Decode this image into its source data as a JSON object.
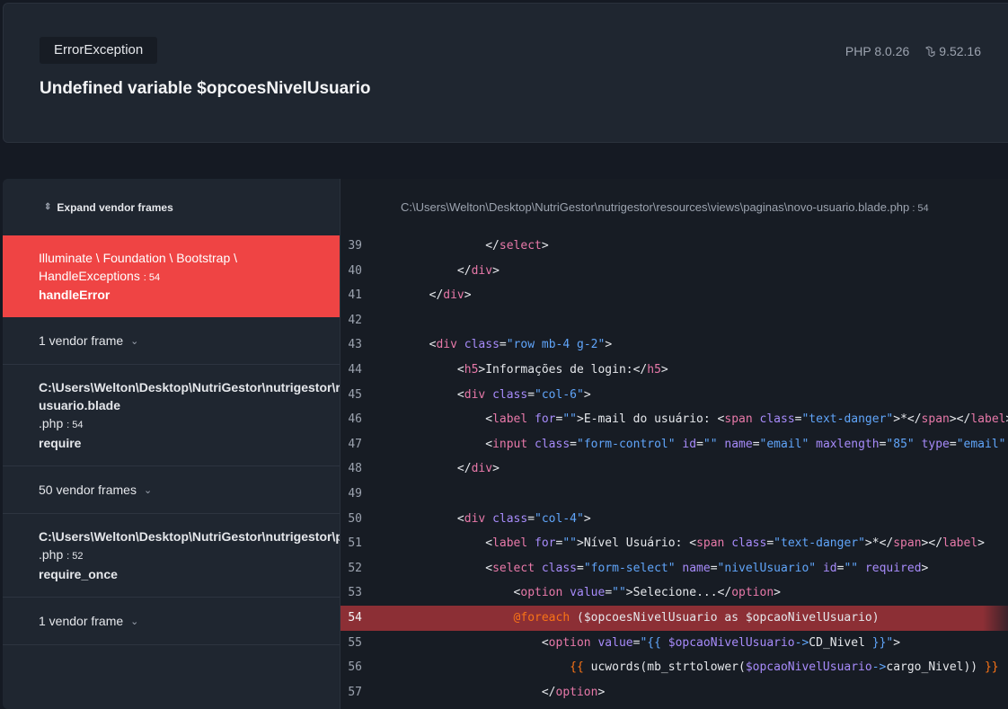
{
  "header": {
    "exception_class": "ErrorException",
    "message": "Undefined variable $opcoesNivelUsuario",
    "php_version": "PHP 8.0.26",
    "laravel_version": "9.52.16"
  },
  "frames_panel": {
    "expand_label": "Expand vendor frames",
    "active_frame": {
      "class_line1": "Illuminate \\ Foundation \\ Bootstrap \\",
      "class_line2": "HandleExceptions",
      "line": ": 54",
      "method": "handleError"
    },
    "vendor_group_1": "1 vendor frame",
    "app_frame_1": {
      "path": "C:\\Users\\Welton\\Desktop\\NutriGestor\\nutrigestor\\resources\\views\\paginas\\novo-",
      "path2": "usuario.blade",
      "ext": ".php",
      "line": ": 54",
      "method": "require"
    },
    "vendor_group_2": "50 vendor frames",
    "app_frame_2": {
      "path": "C:\\Users\\Welton\\Desktop\\NutriGestor\\nutrigestor\\public\\index",
      "ext": ".php",
      "line": ": 52",
      "method": "require_once"
    },
    "vendor_group_3": "1 vendor frame"
  },
  "code_panel": {
    "file_path": "C:\\Users\\Welton\\Desktop\\NutriGestor\\nutrigestor\\resources\\views\\paginas\\novo-usuario.blade",
    "file_ext": ".php",
    "file_line": " : 54",
    "highlight_line": 54,
    "lines": [
      {
        "n": "39",
        "tokens": [
          [
            "t-text",
            "                "
          ],
          [
            "t-punct",
            "</"
          ],
          [
            "t-tag",
            "select"
          ],
          [
            "t-punct",
            ">"
          ]
        ]
      },
      {
        "n": "40",
        "tokens": [
          [
            "t-text",
            "            "
          ],
          [
            "t-punct",
            "</"
          ],
          [
            "t-tag",
            "div"
          ],
          [
            "t-punct",
            ">"
          ]
        ]
      },
      {
        "n": "41",
        "tokens": [
          [
            "t-text",
            "        "
          ],
          [
            "t-punct",
            "</"
          ],
          [
            "t-tag",
            "div"
          ],
          [
            "t-punct",
            ">"
          ]
        ]
      },
      {
        "n": "42",
        "tokens": []
      },
      {
        "n": "43",
        "tokens": [
          [
            "t-text",
            "        "
          ],
          [
            "t-punct",
            "<"
          ],
          [
            "t-tag",
            "div "
          ],
          [
            "t-attr",
            "class"
          ],
          [
            "t-punct",
            "="
          ],
          [
            "t-str",
            "\"row mb-4 g-2\""
          ],
          [
            "t-punct",
            ">"
          ]
        ]
      },
      {
        "n": "44",
        "tokens": [
          [
            "t-text",
            "            "
          ],
          [
            "t-punct",
            "<"
          ],
          [
            "t-tag",
            "h5"
          ],
          [
            "t-punct",
            ">"
          ],
          [
            "t-text",
            "Informações de login:"
          ],
          [
            "t-punct",
            "</"
          ],
          [
            "t-tag",
            "h5"
          ],
          [
            "t-punct",
            ">"
          ]
        ]
      },
      {
        "n": "45",
        "tokens": [
          [
            "t-text",
            "            "
          ],
          [
            "t-punct",
            "<"
          ],
          [
            "t-tag",
            "div "
          ],
          [
            "t-attr",
            "class"
          ],
          [
            "t-punct",
            "="
          ],
          [
            "t-str",
            "\"col-6\""
          ],
          [
            "t-punct",
            ">"
          ]
        ]
      },
      {
        "n": "46",
        "tokens": [
          [
            "t-text",
            "                "
          ],
          [
            "t-punct",
            "<"
          ],
          [
            "t-tag",
            "label "
          ],
          [
            "t-attr",
            "for"
          ],
          [
            "t-punct",
            "="
          ],
          [
            "t-str",
            "\"\""
          ],
          [
            "t-punct",
            ">"
          ],
          [
            "t-text",
            "E-mail do usuário: "
          ],
          [
            "t-punct",
            "<"
          ],
          [
            "t-tag",
            "span "
          ],
          [
            "t-attr",
            "class"
          ],
          [
            "t-punct",
            "="
          ],
          [
            "t-str",
            "\"text-danger\""
          ],
          [
            "t-punct",
            ">"
          ],
          [
            "t-text",
            "*"
          ],
          [
            "t-punct",
            "</"
          ],
          [
            "t-tag",
            "span"
          ],
          [
            "t-punct",
            "></"
          ],
          [
            "t-tag",
            "label"
          ],
          [
            "t-punct",
            ">"
          ]
        ]
      },
      {
        "n": "47",
        "tokens": [
          [
            "t-text",
            "                "
          ],
          [
            "t-punct",
            "<"
          ],
          [
            "t-tag",
            "input "
          ],
          [
            "t-attr",
            "class"
          ],
          [
            "t-punct",
            "="
          ],
          [
            "t-str",
            "\"form-control\" "
          ],
          [
            "t-attr",
            "id"
          ],
          [
            "t-punct",
            "="
          ],
          [
            "t-str",
            "\"\" "
          ],
          [
            "t-attr",
            "name"
          ],
          [
            "t-punct",
            "="
          ],
          [
            "t-str",
            "\"email\" "
          ],
          [
            "t-attr",
            "maxlength"
          ],
          [
            "t-punct",
            "="
          ],
          [
            "t-str",
            "\"85\" "
          ],
          [
            "t-attr",
            "type"
          ],
          [
            "t-punct",
            "="
          ],
          [
            "t-str",
            "\"email\""
          ]
        ]
      },
      {
        "n": "48",
        "tokens": [
          [
            "t-text",
            "            "
          ],
          [
            "t-punct",
            "</"
          ],
          [
            "t-tag",
            "div"
          ],
          [
            "t-punct",
            ">"
          ]
        ]
      },
      {
        "n": "49",
        "tokens": []
      },
      {
        "n": "50",
        "tokens": [
          [
            "t-text",
            "            "
          ],
          [
            "t-punct",
            "<"
          ],
          [
            "t-tag",
            "div "
          ],
          [
            "t-attr",
            "class"
          ],
          [
            "t-punct",
            "="
          ],
          [
            "t-str",
            "\"col-4\""
          ],
          [
            "t-punct",
            ">"
          ]
        ]
      },
      {
        "n": "51",
        "tokens": [
          [
            "t-text",
            "                "
          ],
          [
            "t-punct",
            "<"
          ],
          [
            "t-tag",
            "label "
          ],
          [
            "t-attr",
            "for"
          ],
          [
            "t-punct",
            "="
          ],
          [
            "t-str",
            "\"\""
          ],
          [
            "t-punct",
            ">"
          ],
          [
            "t-text",
            "Nível Usuário: "
          ],
          [
            "t-punct",
            "<"
          ],
          [
            "t-tag",
            "span "
          ],
          [
            "t-attr",
            "class"
          ],
          [
            "t-punct",
            "="
          ],
          [
            "t-str",
            "\"text-danger\""
          ],
          [
            "t-punct",
            ">"
          ],
          [
            "t-text",
            "*"
          ],
          [
            "t-punct",
            "</"
          ],
          [
            "t-tag",
            "span"
          ],
          [
            "t-punct",
            "></"
          ],
          [
            "t-tag",
            "label"
          ],
          [
            "t-punct",
            ">"
          ]
        ]
      },
      {
        "n": "52",
        "tokens": [
          [
            "t-text",
            "                "
          ],
          [
            "t-punct",
            "<"
          ],
          [
            "t-tag",
            "select "
          ],
          [
            "t-attr",
            "class"
          ],
          [
            "t-punct",
            "="
          ],
          [
            "t-str",
            "\"form-select\" "
          ],
          [
            "t-attr",
            "name"
          ],
          [
            "t-punct",
            "="
          ],
          [
            "t-str",
            "\"nivelUsuario\" "
          ],
          [
            "t-attr",
            "id"
          ],
          [
            "t-punct",
            "="
          ],
          [
            "t-str",
            "\"\" "
          ],
          [
            "t-attr",
            "required"
          ],
          [
            "t-punct",
            ">"
          ]
        ]
      },
      {
        "n": "53",
        "tokens": [
          [
            "t-text",
            "                    "
          ],
          [
            "t-punct",
            "<"
          ],
          [
            "t-tag",
            "option "
          ],
          [
            "t-attr",
            "value"
          ],
          [
            "t-punct",
            "="
          ],
          [
            "t-str",
            "\"\""
          ],
          [
            "t-punct",
            ">"
          ],
          [
            "t-text",
            "Selecione..."
          ],
          [
            "t-punct",
            "</"
          ],
          [
            "t-tag",
            "option"
          ],
          [
            "t-punct",
            ">"
          ]
        ]
      },
      {
        "n": "54",
        "tokens": [
          [
            "t-text",
            "                    "
          ],
          [
            "t-dir",
            "@foreach"
          ],
          [
            "t-text",
            " ($opcoesNivelUsuario as $opcaoNivelUsuario)"
          ]
        ]
      },
      {
        "n": "55",
        "tokens": [
          [
            "t-text",
            "                        "
          ],
          [
            "t-punct",
            "<"
          ],
          [
            "t-tag",
            "option "
          ],
          [
            "t-attr",
            "value"
          ],
          [
            "t-punct",
            "="
          ],
          [
            "t-str",
            "\"{{ "
          ],
          [
            "t-var",
            "$opcaoNivelUsuario"
          ],
          [
            "t-str",
            "->"
          ],
          [
            "t-text",
            "CD_Nivel "
          ],
          [
            "t-str",
            "}}\""
          ],
          [
            "t-punct",
            ">"
          ]
        ]
      },
      {
        "n": "56",
        "tokens": [
          [
            "t-text",
            "                            "
          ],
          [
            "t-echo",
            "{{ "
          ],
          [
            "t-text",
            "ucwords(mb_strtolower("
          ],
          [
            "t-var",
            "$opcaoNivelUsuario"
          ],
          [
            "t-str",
            "->"
          ],
          [
            "t-text",
            "cargo_Nivel)) "
          ],
          [
            "t-echo",
            "}}"
          ]
        ]
      },
      {
        "n": "57",
        "tokens": [
          [
            "t-text",
            "                        "
          ],
          [
            "t-punct",
            "</"
          ],
          [
            "t-tag",
            "option"
          ],
          [
            "t-punct",
            ">"
          ]
        ]
      }
    ]
  }
}
